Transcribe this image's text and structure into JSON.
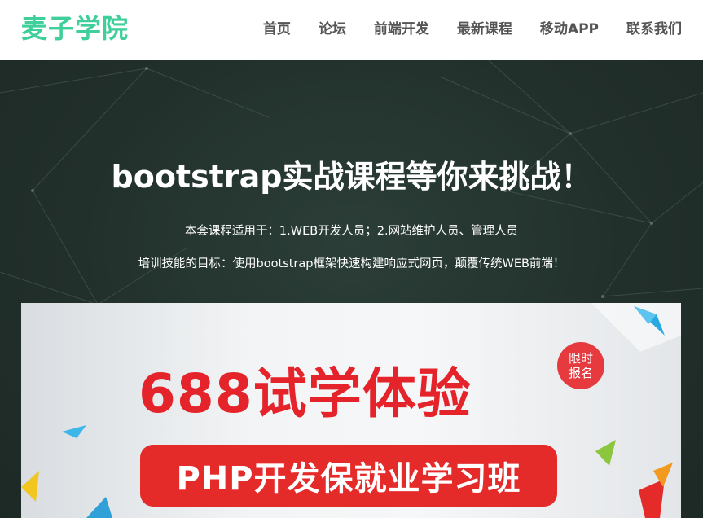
{
  "header": {
    "logo": "麦子学院",
    "nav": [
      "首页",
      "论坛",
      "前端开发",
      "最新课程",
      "移动APP",
      "联系我们"
    ]
  },
  "hero": {
    "title": "bootstrap实战课程等你来挑战！",
    "line1": "本套课程适用于：1.WEB开发人员；2.网站维护人员、管理人员",
    "line2": "培训技能的目标：使用bootstrap框架快速构建响应式网页，颠覆传统WEB前端！"
  },
  "banner": {
    "headline": "688试学体验",
    "subhead": "PHP开发保就业学习班",
    "badge_line1": "限时",
    "badge_line2": "报名"
  },
  "colors": {
    "brand": "#3fcf9b",
    "hero_bg": "#22302b",
    "banner_red": "#e52a2a"
  }
}
